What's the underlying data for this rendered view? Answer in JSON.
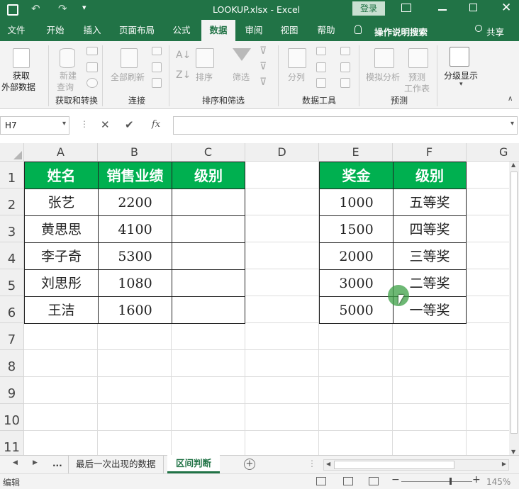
{
  "title_bar": {
    "file_title": "LOOKUP.xlsx  -  Excel",
    "login_label": "登录"
  },
  "ribbon_tabs": [
    {
      "label": "文件"
    },
    {
      "label": "开始"
    },
    {
      "label": "插入"
    },
    {
      "label": "页面布局"
    },
    {
      "label": "公式"
    },
    {
      "label": "数据",
      "active": true
    },
    {
      "label": "审阅"
    },
    {
      "label": "视图"
    },
    {
      "label": "帮助"
    }
  ],
  "tell_me": "操作说明搜索",
  "share_label": "共享",
  "ribbon": {
    "get_external_data": [
      "获取",
      "外部数据"
    ],
    "new_query": [
      "新建",
      "查询"
    ],
    "refresh_all": "全部刷新",
    "sort": "排序",
    "filter": "筛选",
    "text_to_columns": "分列",
    "what_if": "模拟分析",
    "forecast_sheet": [
      "预测",
      "工作表"
    ],
    "outline": "分级显示",
    "groups": [
      "获取和转换",
      "连接",
      "排序和筛选",
      "数据工具",
      "预测"
    ]
  },
  "formula_bar": {
    "name_box": "H7",
    "fx": "fx",
    "formula": ""
  },
  "columns": [
    "A",
    "B",
    "C",
    "D",
    "E",
    "F",
    "G"
  ],
  "rows": [
    "1",
    "2",
    "3",
    "4",
    "5",
    "6",
    "7",
    "8",
    "9",
    "10",
    "11"
  ],
  "table_left": {
    "headers": [
      "姓名",
      "销售业绩",
      "级别"
    ],
    "rows": [
      [
        "张艺",
        "2200",
        ""
      ],
      [
        "黄思思",
        "4100",
        ""
      ],
      [
        "李子奇",
        "5300",
        ""
      ],
      [
        "刘思彤",
        "1080",
        ""
      ],
      [
        "王洁",
        "1600",
        ""
      ]
    ]
  },
  "table_right": {
    "headers": [
      "奖金",
      "级别"
    ],
    "rows": [
      [
        "1000",
        "五等奖"
      ],
      [
        "1500",
        "四等奖"
      ],
      [
        "2000",
        "三等奖"
      ],
      [
        "3000",
        "二等奖"
      ],
      [
        "5000",
        "一等奖"
      ]
    ]
  },
  "sheet_tabs": {
    "ellipsis": "...",
    "tabs": [
      {
        "label": "最后一次出现的数据",
        "active": false
      },
      {
        "label": "区间判断",
        "active": true
      }
    ]
  },
  "status": {
    "mode": "编辑",
    "zoom": "145%"
  },
  "colors": {
    "excel_green": "#217346",
    "header_fill": "#00b050"
  }
}
